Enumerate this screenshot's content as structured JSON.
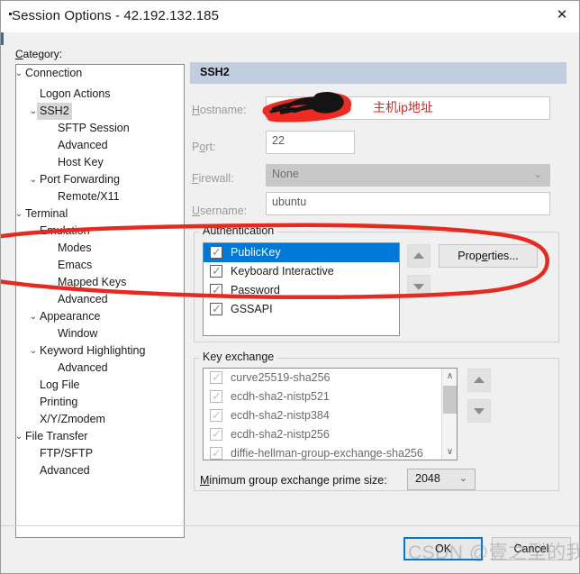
{
  "window": {
    "title": "Session Options - 42.192.132.185",
    "close_icon": "close-icon",
    "close_glyph": "✕"
  },
  "category": {
    "label": "Category:",
    "label_mnemonic": "C",
    "tree": [
      {
        "label": "Connection",
        "depth": 0,
        "expander": "⌄",
        "selected": false
      },
      {
        "label": "Logon Actions",
        "depth": 1,
        "expander": "",
        "selected": false
      },
      {
        "label": "SSH2",
        "depth": 1,
        "expander": "⌄",
        "selected": true
      },
      {
        "label": "SFTP Session",
        "depth": 2,
        "expander": "",
        "selected": false
      },
      {
        "label": "Advanced",
        "depth": 2,
        "expander": "",
        "selected": false
      },
      {
        "label": "Host Key",
        "depth": 2,
        "expander": "",
        "selected": false
      },
      {
        "label": "Port Forwarding",
        "depth": 1,
        "expander": "⌄",
        "selected": false
      },
      {
        "label": "Remote/X11",
        "depth": 2,
        "expander": "",
        "selected": false
      },
      {
        "label": "Terminal",
        "depth": 0,
        "expander": "⌄",
        "selected": false
      },
      {
        "label": "Emulation",
        "depth": 1,
        "expander": "⌄",
        "selected": false
      },
      {
        "label": "Modes",
        "depth": 2,
        "expander": "",
        "selected": false
      },
      {
        "label": "Emacs",
        "depth": 2,
        "expander": "",
        "selected": false
      },
      {
        "label": "Mapped Keys",
        "depth": 2,
        "expander": "",
        "selected": false
      },
      {
        "label": "Advanced",
        "depth": 2,
        "expander": "",
        "selected": false
      },
      {
        "label": "Appearance",
        "depth": 1,
        "expander": "⌄",
        "selected": false
      },
      {
        "label": "Window",
        "depth": 2,
        "expander": "",
        "selected": false
      },
      {
        "label": "Keyword Highlighting",
        "depth": 1,
        "expander": "⌄",
        "selected": false
      },
      {
        "label": "Advanced",
        "depth": 2,
        "expander": "",
        "selected": false
      },
      {
        "label": "Log File",
        "depth": 1,
        "expander": "",
        "selected": false
      },
      {
        "label": "Printing",
        "depth": 1,
        "expander": "",
        "selected": false
      },
      {
        "label": "X/Y/Zmodem",
        "depth": 1,
        "expander": "",
        "selected": false
      },
      {
        "label": "File Transfer",
        "depth": 0,
        "expander": "⌄",
        "selected": false
      },
      {
        "label": "FTP/SFTP",
        "depth": 1,
        "expander": "",
        "selected": false
      },
      {
        "label": "Advanced",
        "depth": 1,
        "expander": "",
        "selected": false
      }
    ]
  },
  "panel": {
    "header": "SSH2",
    "fields": {
      "hostname": {
        "label_pre": "H",
        "label_post": "ostname:",
        "value": ""
      },
      "port": {
        "label_pre": "P",
        "label_mid": "o",
        "label_post": "rt:",
        "value": "22"
      },
      "firewall": {
        "label_pre": "F",
        "label_post": "irewall:",
        "value": "None",
        "caret": "⌄"
      },
      "username": {
        "label_pre": "U",
        "label_post": "sername:",
        "value": "ubuntu"
      }
    }
  },
  "authentication": {
    "title": "Authentication",
    "methods": [
      {
        "label": "PublicKey",
        "checked": true,
        "selected": true
      },
      {
        "label": "Keyboard Interactive",
        "checked": true,
        "selected": false
      },
      {
        "label": "Password",
        "checked": true,
        "selected": false
      },
      {
        "label": "GSSAPI",
        "checked": true,
        "selected": false
      }
    ],
    "move_up_icon": "arrow-up-icon",
    "move_down_icon": "arrow-down-icon",
    "properties_button": {
      "pre": "Prop",
      "mn": "e",
      "post": "rties..."
    }
  },
  "key_exchange": {
    "title": "Key exchange",
    "algorithms": [
      {
        "label": "curve25519-sha256",
        "checked": true
      },
      {
        "label": "ecdh-sha2-nistp521",
        "checked": true
      },
      {
        "label": "ecdh-sha2-nistp384",
        "checked": true
      },
      {
        "label": "ecdh-sha2-nistp256",
        "checked": true
      },
      {
        "label": "diffie-hellman-group-exchange-sha256",
        "checked": true
      }
    ],
    "scroll_up_glyph": "∧",
    "scroll_down_glyph": "∨",
    "move_up_icon": "arrow-up-icon",
    "move_down_icon": "arrow-down-icon",
    "prime_size": {
      "label_pre": "M",
      "label_post": "inimum group exchange prime size:",
      "value": "2048",
      "caret": "⌄"
    }
  },
  "footer": {
    "ok": "OK",
    "cancel": "Cancel"
  },
  "annotations": {
    "ip_note": "主机ip地址",
    "watermark": "CSDN @壹之型的我",
    "redaction_color": "#ee2b22",
    "circle_color": "#e62a20"
  }
}
